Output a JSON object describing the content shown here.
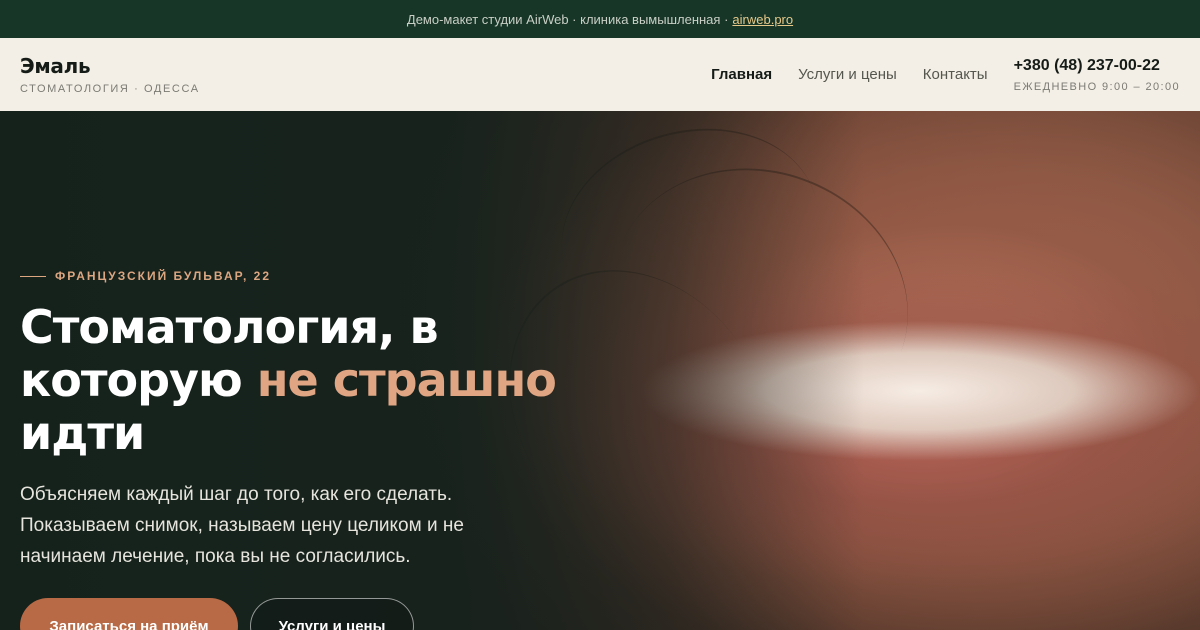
{
  "demo_bar": {
    "text": "Демо-макет студии AirWeb · клиника вымышленная ·",
    "link": "airweb.pro"
  },
  "header": {
    "brand": "Эмаль",
    "brand_sub": "СТОМАТОЛОГИЯ · ОДЕССА",
    "nav": [
      {
        "label": "Главная",
        "active": true
      },
      {
        "label": "Услуги и цены",
        "active": false
      },
      {
        "label": "Контакты",
        "active": false
      }
    ],
    "phone": "+380 (48) 237-00-22",
    "hours": "ЕЖЕДНЕВНО 9:00 – 20:00"
  },
  "hero": {
    "eyebrow": "ФРАНЦУЗСКИЙ БУЛЬВАР, 22",
    "headline_start": "Стоматология, в которую ",
    "headline_accent": "не страшно",
    "headline_end": " идти",
    "lead": "Объясняем каждый шаг до того, как его сделать. Показываем снимок, называем цену целиком и не начинаем лечение, пока вы не согласились.",
    "primary_button": "Записаться на приём",
    "secondary_button": "Услуги и цены"
  },
  "colors": {
    "demo_bar_bg": "#173628",
    "header_bg": "#f3efe6",
    "accent": "#e0a684",
    "primary_button": "#b76a45"
  }
}
